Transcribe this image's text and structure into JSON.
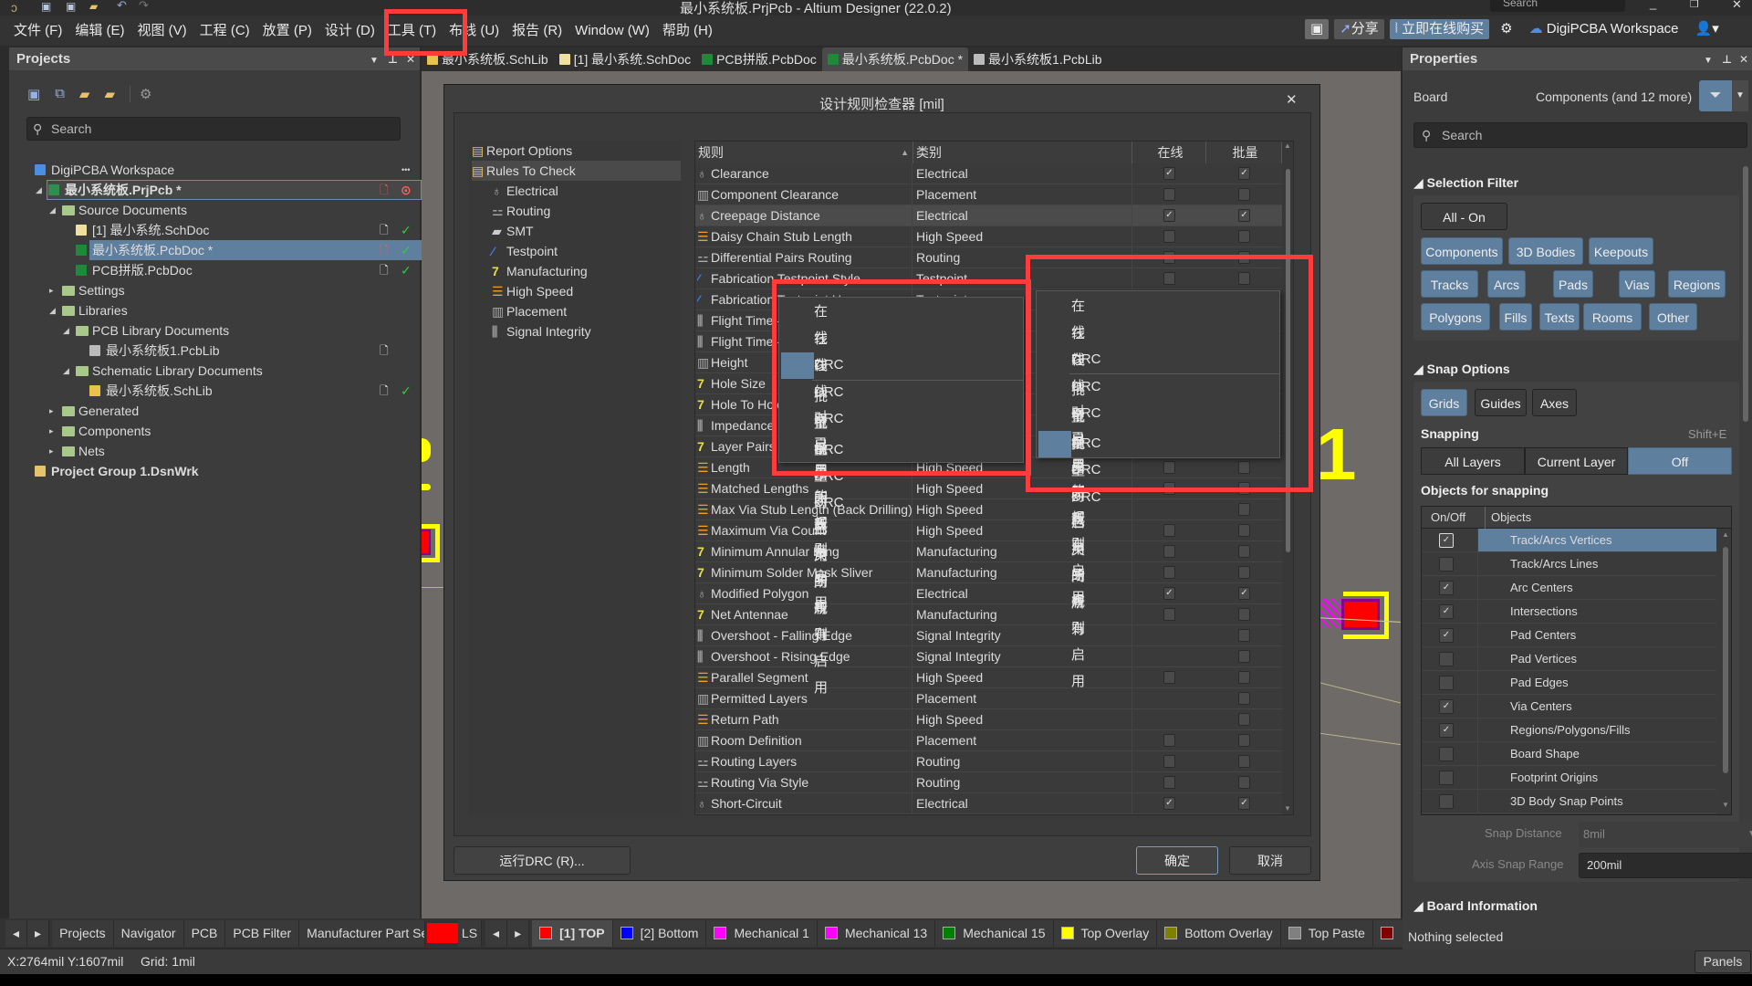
{
  "window": {
    "title": "最小系统板.PrjPcb - Altium Designer (22.0.2)",
    "search_placeholder": "Search"
  },
  "menu": [
    "文件 (F)",
    "编辑 (E)",
    "视图 (V)",
    "工程 (C)",
    "放置 (P)",
    "设计 (D)",
    "工具 (T)",
    "布线 (U)",
    "报告 (R)",
    "Window (W)",
    "帮助 (H)"
  ],
  "toolbar_right": {
    "share": "分享",
    "buy": "立即在线购买",
    "workspace": "DigiPCBA Workspace"
  },
  "doc_tabs": [
    {
      "label": "最小系统板.SchLib",
      "icon": "schlib-icon",
      "active": false
    },
    {
      "label": "[1] 最小系统.SchDoc",
      "icon": "schdoc-icon",
      "active": false
    },
    {
      "label": "PCB拼版.PcbDoc",
      "icon": "pcbdoc-icon",
      "active": false
    },
    {
      "label": "最小系统板.PcbDoc *",
      "icon": "pcbdoc-icon",
      "active": true
    },
    {
      "label": "最小系统板1.PcbLib",
      "icon": "pcblib-icon",
      "active": false
    }
  ],
  "projects": {
    "title": "Projects",
    "search_placeholder": "Search",
    "tree": [
      {
        "label": "DigiPCBA Workspace",
        "level": 0,
        "icon": "cloud-icon",
        "more": "•••"
      },
      {
        "label": "最小系统板.PrjPcb *",
        "level": 1,
        "expanded": true,
        "icon": "project-icon",
        "bold": true,
        "focused": true,
        "doc": "modified",
        "status": "error"
      },
      {
        "label": "Source Documents",
        "level": 2,
        "expanded": true,
        "icon": "folder-icon"
      },
      {
        "label": "[1] 最小系统.SchDoc",
        "level": 3,
        "icon": "schdoc-icon",
        "doc": "saved",
        "status": "ok"
      },
      {
        "label": "最小系统板.PcbDoc *",
        "level": 3,
        "icon": "pcbdoc-icon",
        "selected": true,
        "doc": "modified",
        "status": "ok"
      },
      {
        "label": "PCB拼版.PcbDoc",
        "level": 3,
        "icon": "pcbdoc-icon",
        "doc": "saved",
        "status": "ok"
      },
      {
        "label": "Settings",
        "level": 2,
        "expanded": false,
        "icon": "folder-icon"
      },
      {
        "label": "Libraries",
        "level": 2,
        "expanded": true,
        "icon": "folder-icon"
      },
      {
        "label": "PCB Library Documents",
        "level": 3,
        "expanded": true,
        "icon": "folder-icon"
      },
      {
        "label": "最小系统板1.PcbLib",
        "level": 4,
        "icon": "pcblib-icon",
        "doc": "saved"
      },
      {
        "label": "Schematic Library Documents",
        "level": 3,
        "expanded": true,
        "icon": "folder-icon"
      },
      {
        "label": "最小系统板.SchLib",
        "level": 4,
        "icon": "schlib-icon",
        "doc": "saved",
        "status": "ok"
      },
      {
        "label": "Generated",
        "level": 2,
        "expanded": false,
        "icon": "folder-icon"
      },
      {
        "label": "Components",
        "level": 2,
        "expanded": false,
        "icon": "folder-icon"
      },
      {
        "label": "Nets",
        "level": 2,
        "expanded": false,
        "icon": "folder-icon"
      },
      {
        "label": "Project Group 1.DsnWrk",
        "level": 0,
        "icon": "project-group-icon",
        "bold": true
      }
    ]
  },
  "dialog": {
    "title": "设计规则检查器 [mil]",
    "tree": [
      {
        "label": "Report Options",
        "level": 0,
        "icon": "folder-icon"
      },
      {
        "label": "Rules To Check",
        "level": 0,
        "icon": "folder-icon",
        "selected": true
      },
      {
        "label": "Electrical",
        "level": 1,
        "icon": "electrical-icon"
      },
      {
        "label": "Routing",
        "level": 1,
        "icon": "routing-icon"
      },
      {
        "label": "SMT",
        "level": 1,
        "icon": "smt-icon"
      },
      {
        "label": "Testpoint",
        "level": 1,
        "icon": "testpoint-icon"
      },
      {
        "label": "Manufacturing",
        "level": 1,
        "icon": "manufacturing-icon"
      },
      {
        "label": "High Speed",
        "level": 1,
        "icon": "highspeed-icon"
      },
      {
        "label": "Placement",
        "level": 1,
        "icon": "placement-icon"
      },
      {
        "label": "Signal Integrity",
        "level": 1,
        "icon": "signal-integrity-icon"
      }
    ],
    "columns": {
      "rule": "规则",
      "category": "类别",
      "online": "在线",
      "batch": "批量"
    },
    "rules": [
      {
        "rule": "Clearance",
        "category": "Electrical",
        "online": true,
        "batch": true
      },
      {
        "rule": "Component Clearance",
        "category": "Placement",
        "online": false,
        "batch": false
      },
      {
        "rule": "Creepage Distance",
        "category": "Electrical",
        "online": true,
        "batch": true,
        "highlighted": true
      },
      {
        "rule": "Daisy Chain Stub Length",
        "category": "High Speed",
        "online": false,
        "batch": false
      },
      {
        "rule": "Differential Pairs Routing",
        "category": "Routing",
        "online": false,
        "batch": false
      },
      {
        "rule": "Fabrication Testpoint Style",
        "category": "Testpoint",
        "online": false,
        "batch": false
      },
      {
        "rule": "Fabrication Testpoint Usage",
        "category": "Testpoint",
        "online": false,
        "batch": false
      },
      {
        "rule": "Flight Time - Falling Edge",
        "category": "Signal Integrity",
        "online": null,
        "batch": false
      },
      {
        "rule": "Flight Time - Rising Edge",
        "category": "Signal Integrity",
        "online": null,
        "batch": false
      },
      {
        "rule": "Height",
        "category": "Placement",
        "online": false,
        "batch": false
      },
      {
        "rule": "Hole Size",
        "category": "Manufacturing",
        "online": false,
        "batch": false
      },
      {
        "rule": "Hole To Hole Clearance",
        "category": "Manufacturing",
        "online": false,
        "batch": false
      },
      {
        "rule": "Impedance",
        "category": "Signal Integrity",
        "online": null,
        "batch": false
      },
      {
        "rule": "Layer Pairs",
        "category": "Manufacturing",
        "online": false,
        "batch": false
      },
      {
        "rule": "Length",
        "category": "High Speed",
        "online": false,
        "batch": false
      },
      {
        "rule": "Matched Lengths",
        "category": "High Speed",
        "online": false,
        "batch": false
      },
      {
        "rule": "Max Via Stub Length (Back Drilling)",
        "category": "High Speed",
        "online": null,
        "batch": false
      },
      {
        "rule": "Maximum Via Count",
        "category": "High Speed",
        "online": false,
        "batch": false
      },
      {
        "rule": "Minimum Annular Ring",
        "category": "Manufacturing",
        "online": false,
        "batch": false
      },
      {
        "rule": "Minimum Solder Mask Sliver",
        "category": "Manufacturing",
        "online": false,
        "batch": false
      },
      {
        "rule": "Modified Polygon",
        "category": "Electrical",
        "online": true,
        "batch": true
      },
      {
        "rule": "Net Antennae",
        "category": "Manufacturing",
        "online": false,
        "batch": false
      },
      {
        "rule": "Overshoot - Falling Edge",
        "category": "Signal Integrity",
        "online": null,
        "batch": false
      },
      {
        "rule": "Overshoot - Rising Edge",
        "category": "Signal Integrity",
        "online": null,
        "batch": false
      },
      {
        "rule": "Parallel Segment",
        "category": "High Speed",
        "online": false,
        "batch": false
      },
      {
        "rule": "Permitted Layers",
        "category": "Placement",
        "online": null,
        "batch": false
      },
      {
        "rule": "Return Path",
        "category": "High Speed",
        "online": null,
        "batch": false
      },
      {
        "rule": "Room Definition",
        "category": "Placement",
        "online": false,
        "batch": false
      },
      {
        "rule": "Routing Layers",
        "category": "Routing",
        "online": false,
        "batch": false
      },
      {
        "rule": "Routing Via Style",
        "category": "Routing",
        "online": false,
        "batch": false
      },
      {
        "rule": "Short-Circuit",
        "category": "Electrical",
        "online": true,
        "batch": true
      }
    ],
    "context_menu_1": {
      "items": [
        "在线DRC - 对已用的规则启用",
        "在线DRC - 启用所有",
        "在线DRC - 关闭所有",
        "批量DRC - 对已用的规则启用",
        "批量DRC - 启用所有",
        "批量DRC - 关闭所有"
      ],
      "selected_index": 2
    },
    "context_menu_2": {
      "items": [
        "在线DRC - 对已用的规则启用",
        "在线DRC - 启用所有",
        "在线DRC - 关闭所有",
        "批量DRC - 对已用的规则启用",
        "批量DRC - 启用所有",
        "批量DRC - 关闭所有"
      ],
      "selected_index": 5
    },
    "run_button": "运行DRC (R)...",
    "ok_button": "确定",
    "cancel_button": "取消"
  },
  "properties": {
    "title": "Properties",
    "object": "Board",
    "filter_summary": "Components (and 12 more)",
    "search_placeholder": "Search",
    "selection_filter": {
      "title": "Selection Filter",
      "all_on": "All - On",
      "buttons": [
        [
          "Components",
          "3D Bodies",
          "Keepouts"
        ],
        [
          "Tracks",
          "Arcs",
          "Pads",
          "Vias",
          "Regions"
        ],
        [
          "Polygons",
          "Fills",
          "Texts",
          "Rooms",
          "Other"
        ]
      ]
    },
    "snap_options": {
      "title": "Snap Options",
      "modes": [
        {
          "label": "Grids",
          "on": true
        },
        {
          "label": "Guides",
          "on": false
        },
        {
          "label": "Axes",
          "on": false
        }
      ],
      "snapping_label": "Snapping",
      "shortcut": "Shift+E",
      "snapping": [
        {
          "label": "All Layers",
          "on": false
        },
        {
          "label": "Current Layer",
          "on": false
        },
        {
          "label": "Off",
          "on": true
        }
      ],
      "objects_title": "Objects for snapping",
      "col_onoff": "On/Off",
      "col_objects": "Objects",
      "objects": [
        {
          "name": "Track/Arcs Vertices",
          "on": true,
          "selected": true
        },
        {
          "name": "Track/Arcs Lines",
          "on": false
        },
        {
          "name": "Arc Centers",
          "on": true
        },
        {
          "name": "Intersections",
          "on": true
        },
        {
          "name": "Pad Centers",
          "on": true
        },
        {
          "name": "Pad Vertices",
          "on": false
        },
        {
          "name": "Pad Edges",
          "on": false
        },
        {
          "name": "Via Centers",
          "on": true
        },
        {
          "name": "Regions/Polygons/Fills",
          "on": true
        },
        {
          "name": "Board Shape",
          "on": false
        },
        {
          "name": "Footprint Origins",
          "on": false
        },
        {
          "name": "3D Body Snap Points",
          "on": false
        }
      ],
      "snap_distance_label": "Snap Distance",
      "snap_distance": "8mil",
      "axis_snap_label": "Axis Snap Range",
      "axis_snap": "200mil"
    },
    "board_info_title": "Board Information",
    "status": "Nothing selected"
  },
  "bottom": {
    "panel_tabs": [
      "Projects",
      "Navigator",
      "PCB",
      "PCB Filter",
      "Manufacturer Part Se"
    ],
    "ls": "LS",
    "layers": [
      {
        "label": "[1] TOP",
        "color": "#ff0000",
        "active": true
      },
      {
        "label": "[2] Bottom",
        "color": "#0000ff"
      },
      {
        "label": "Mechanical 1",
        "color": "#ff00ff"
      },
      {
        "label": "Mechanical 13",
        "color": "#ff00ff"
      },
      {
        "label": "Mechanical 15",
        "color": "#008000"
      },
      {
        "label": "Top Overlay",
        "color": "#ffff00"
      },
      {
        "label": "Bottom Overlay",
        "color": "#808000"
      },
      {
        "label": "Top Paste",
        "color": "#808080"
      },
      {
        "label": "",
        "color": "#800000"
      }
    ]
  },
  "status": {
    "coords": "X:2764mil Y:1607mil",
    "grid": "Grid: 1mil",
    "panels": "Panels"
  },
  "colors": {
    "accent": "#5f7f9f",
    "highlight_box": "#ff3b3b",
    "canvas": "#6e6a68",
    "overlay": "#ffff00",
    "pad": "#ff0000"
  }
}
